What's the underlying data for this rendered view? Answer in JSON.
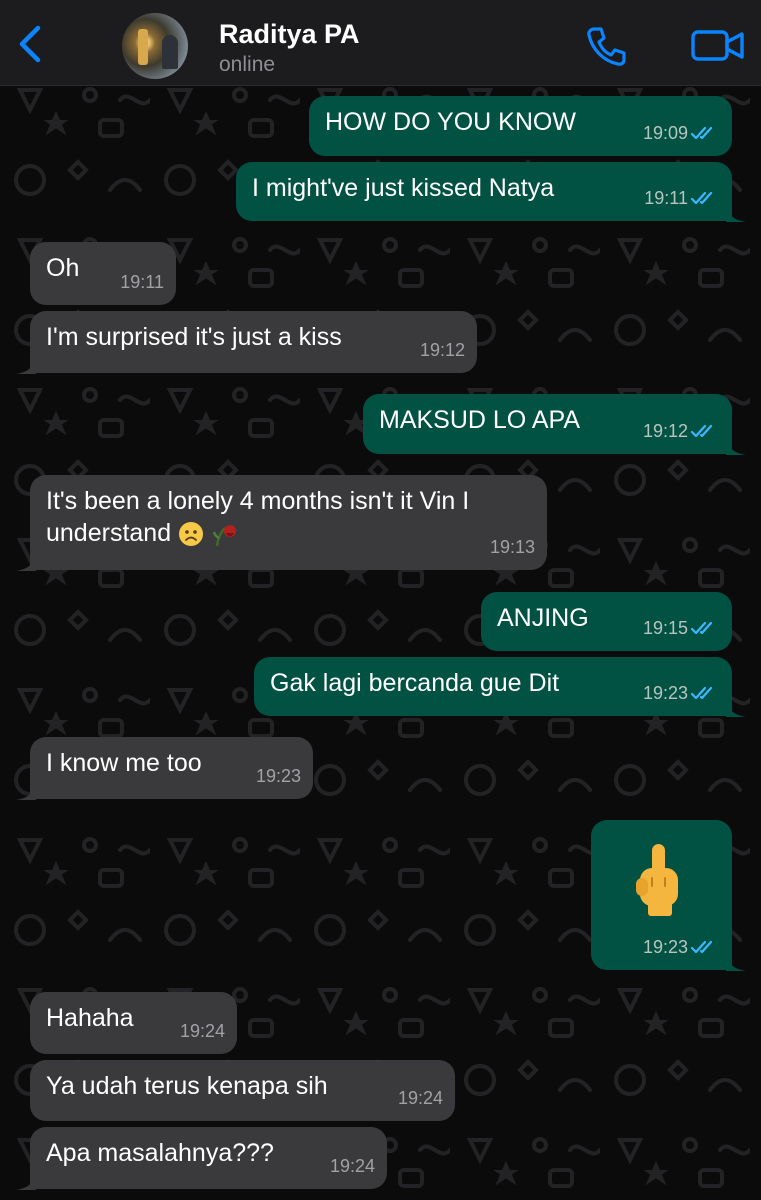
{
  "header": {
    "contact_name": "Raditya PA",
    "status": "online",
    "icons": [
      "chevron-left-icon",
      "phone-icon",
      "video-camera-icon"
    ],
    "accent_color": "#0a84ff"
  },
  "colors": {
    "incoming_bubble": "#3a3a3c",
    "outgoing_bubble": "#025244",
    "header_bg": "#1c1c1e"
  },
  "messages": [
    {
      "dir": "out",
      "text": "HOW DO YOU KNOW",
      "time": "19:09",
      "read": true
    },
    {
      "dir": "out",
      "text": "I might've just kissed Natya",
      "time": "19:11",
      "read": true
    },
    {
      "dir": "in",
      "text": "Oh",
      "time": "19:11"
    },
    {
      "dir": "in",
      "text": "I'm surprised it's just a kiss",
      "time": "19:12"
    },
    {
      "dir": "out",
      "text": "MAKSUD LO APA",
      "time": "19:12",
      "read": true
    },
    {
      "dir": "in",
      "text": "It's been a lonely 4 months isn't it Vin I understand",
      "emojis": [
        "frowning-face-emoji",
        "wilted-rose-emoji"
      ],
      "time": "19:13"
    },
    {
      "dir": "out",
      "text": "ANJING",
      "time": "19:15",
      "read": true
    },
    {
      "dir": "out",
      "text": "Gak lagi bercanda gue Dit",
      "time": "19:23",
      "read": true
    },
    {
      "dir": "in",
      "text": "I know me too",
      "time": "19:23"
    },
    {
      "dir": "out",
      "emoji": "middle-finger-emoji",
      "time": "19:23",
      "read": true
    },
    {
      "dir": "in",
      "text": "Hahaha",
      "time": "19:24"
    },
    {
      "dir": "in",
      "text": "Ya udah terus kenapa sih",
      "time": "19:24"
    },
    {
      "dir": "in",
      "text": "Apa masalahnya???",
      "time": "19:24"
    }
  ]
}
